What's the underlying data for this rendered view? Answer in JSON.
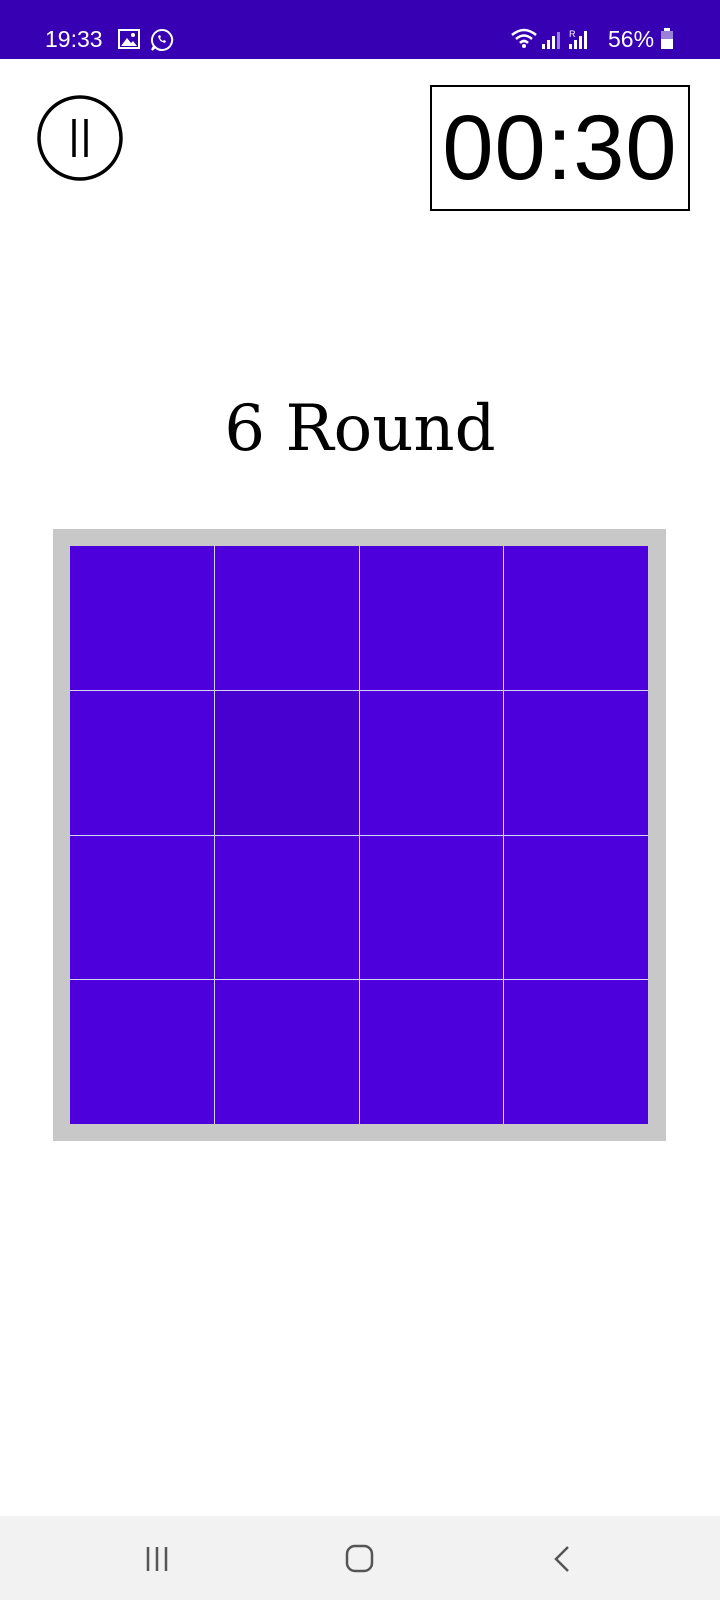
{
  "status_bar": {
    "time": "19:33",
    "battery": "56%",
    "icons": [
      "gallery-icon",
      "whatsapp-icon",
      "wifi-icon",
      "signal-icon",
      "signal-r-icon",
      "battery-icon"
    ]
  },
  "game": {
    "timer": "00:30",
    "round_label": "6 Round",
    "grid_size": 4,
    "tile_color": "#4d00db",
    "odd_tile_color": "#4800d0",
    "odd_tile_index": 5
  },
  "nav": {
    "icons": [
      "recent-apps-icon",
      "home-icon",
      "back-icon"
    ]
  },
  "colors": {
    "status_bar": "#3700b3",
    "board_frame": "#c8c8c8"
  }
}
